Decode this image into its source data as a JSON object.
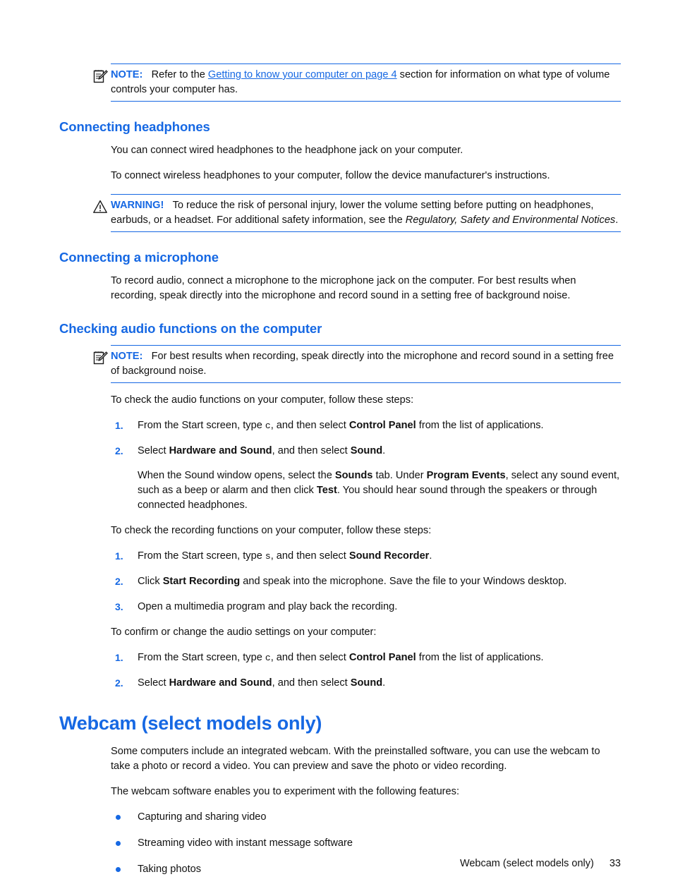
{
  "note_top": {
    "icon": "note-pad-pencil-icon",
    "label": "NOTE:",
    "text_before_link": "Refer to the ",
    "link_text": "Getting to know your computer on page 4",
    "text_after_link": " section for information on what type of volume controls your computer has."
  },
  "section_headphones": {
    "heading": "Connecting headphones",
    "para1": "You can connect wired headphones to the headphone jack on your computer.",
    "para2": "To connect wireless headphones to your computer, follow the device manufacturer's instructions.",
    "warning": {
      "icon": "warning-triangle-icon",
      "label": "WARNING!",
      "text1": "To reduce the risk of personal injury, lower the volume setting before putting on headphones, earbuds, or a headset. For additional safety information, see the ",
      "italic_title": "Regulatory, Safety and Environmental Notices",
      "text2": "."
    }
  },
  "section_microphone": {
    "heading": "Connecting a microphone",
    "para1": "To record audio, connect a microphone to the microphone jack on the computer. For best results when recording, speak directly into the microphone and record sound in a setting free of background noise."
  },
  "section_checking_audio": {
    "heading": "Checking audio functions on the computer",
    "note": {
      "icon": "note-pad-pencil-icon",
      "label": "NOTE:",
      "text": "For best results when recording, speak directly into the microphone and record sound in a setting free of background noise."
    },
    "intro_audio": "To check the audio functions on your computer, follow these steps:",
    "audio_steps": [
      {
        "num": "1.",
        "t1": "From the Start screen, type ",
        "mono": "c",
        "t2": ", and then select ",
        "b1": "Control Panel",
        "t3": " from the list of applications."
      },
      {
        "num": "2.",
        "t1": "Select ",
        "b1": "Hardware and Sound",
        "t2": ", and then select ",
        "b2": "Sound",
        "t3": ".",
        "sub_t1": "When the Sound window opens, select the ",
        "sub_b1": "Sounds",
        "sub_t2": " tab. Under ",
        "sub_b2": "Program Events",
        "sub_t3": ", select any sound event, such as a beep or alarm and then click ",
        "sub_b3": "Test",
        "sub_t4": ". You should hear sound through the speakers or through connected headphones."
      }
    ],
    "intro_recording": "To check the recording functions on your computer, follow these steps:",
    "recording_steps": [
      {
        "num": "1.",
        "t1": "From the Start screen, type ",
        "mono": "s",
        "t2": ", and then select ",
        "b1": "Sound Recorder",
        "t3": "."
      },
      {
        "num": "2.",
        "t1": "Click ",
        "b1": "Start Recording",
        "t2": " and speak into the microphone. Save the file to your Windows desktop."
      },
      {
        "num": "3.",
        "t1": "Open a multimedia program and play back the recording."
      }
    ],
    "intro_settings": "To confirm or change the audio settings on your computer:",
    "settings_steps": [
      {
        "num": "1.",
        "t1": "From the Start screen, type ",
        "mono": "c",
        "t2": ", and then select ",
        "b1": "Control Panel",
        "t3": " from the list of applications."
      },
      {
        "num": "2.",
        "t1": "Select ",
        "b1": "Hardware and Sound",
        "t2": ", and then select ",
        "b2": "Sound",
        "t3": "."
      }
    ]
  },
  "section_webcam": {
    "heading": "Webcam (select models only)",
    "para1": "Some computers include an integrated webcam. With the preinstalled software, you can use the webcam to take a photo or record a video. You can preview and save the photo or video recording.",
    "para2": "The webcam software enables you to experiment with the following features:",
    "bullets": [
      "Capturing and sharing video",
      "Streaming video with instant message software",
      "Taking photos"
    ]
  },
  "footer": {
    "title": "Webcam (select models only)",
    "page_number": "33"
  },
  "colors": {
    "accent_blue": "#1668E3",
    "text": "#111111",
    "background": "#FFFFFF"
  }
}
